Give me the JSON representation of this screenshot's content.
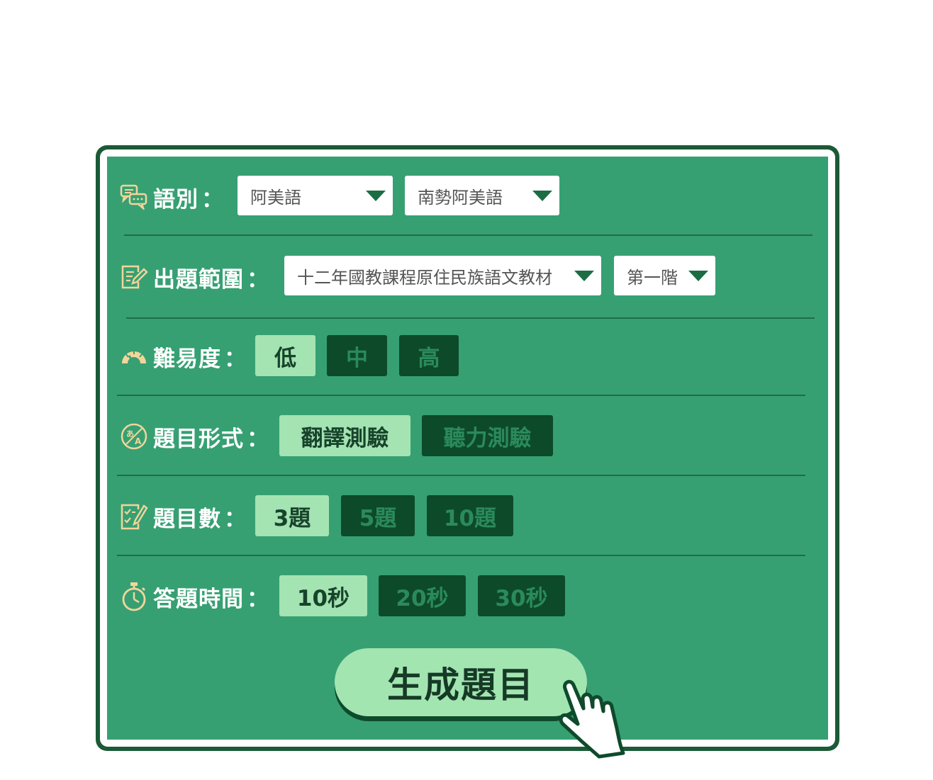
{
  "language": {
    "label": "語別",
    "colon": "：",
    "select1": "阿美語",
    "select2": "南勢阿美語"
  },
  "scope": {
    "label": "出題範圍",
    "colon": "：",
    "select1": "十二年國教課程原住民族語文教材",
    "select2": "第一階"
  },
  "difficulty": {
    "label": "難易度",
    "colon": "：",
    "options": [
      "低",
      "中",
      "高"
    ],
    "selected": "低"
  },
  "format": {
    "label": "題目形式",
    "colon": "：",
    "options": [
      "翻譯測驗",
      "聽力測驗"
    ],
    "selected": "翻譯測驗"
  },
  "count": {
    "label": "題目數",
    "colon": "：",
    "options": [
      "3題",
      "5題",
      "10題"
    ],
    "selected": "3題"
  },
  "time": {
    "label": "答題時間",
    "colon": "：",
    "options": [
      "10秒",
      "20秒",
      "30秒"
    ],
    "selected": "10秒"
  },
  "generate_button": "生成題目",
  "colors": {
    "panel_bg": "#36a073",
    "selected_option": "#a4e3b2",
    "unselected_option": "#0d4a2a",
    "icon_gold": "#f3d59a"
  }
}
